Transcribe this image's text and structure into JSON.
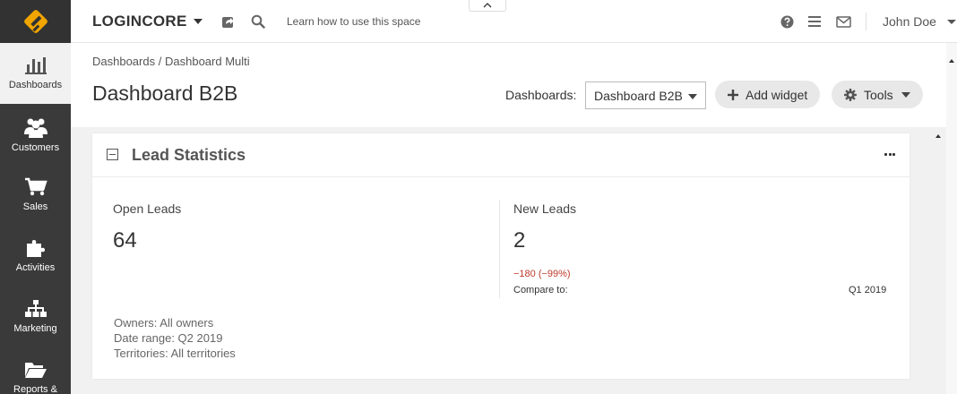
{
  "sidebar": {
    "items": [
      {
        "label": "Dashboards",
        "icon": "bar-chart-icon",
        "active": true
      },
      {
        "label": "Customers",
        "icon": "users-icon",
        "active": false
      },
      {
        "label": "Sales",
        "icon": "cart-icon",
        "active": false
      },
      {
        "label": "Activities",
        "icon": "puzzle-icon",
        "active": false
      },
      {
        "label": "Marketing",
        "icon": "sitemap-icon",
        "active": false
      },
      {
        "label": "Reports &",
        "icon": "folder-open-icon",
        "active": false
      }
    ]
  },
  "header": {
    "brand": "LOGINCORE",
    "learn_link": "Learn how to use this space",
    "user_name": "John Doe"
  },
  "page": {
    "breadcrumb": {
      "root": "Dashboards",
      "separator": "/",
      "current": "Dashboard Multi"
    },
    "title": "Dashboard B2B",
    "dashboards_label": "Dashboards:",
    "dashboards_selected": "Dashboard B2B",
    "add_widget_label": "Add widget",
    "tools_label": "Tools"
  },
  "widget": {
    "title": "Lead Statistics",
    "open_leads": {
      "label": "Open Leads",
      "value": "64"
    },
    "new_leads": {
      "label": "New Leads",
      "value": "2",
      "delta": "−180 (−99%)",
      "compare_label": "Compare to:",
      "compare_value": "Q1 2019"
    },
    "filters": {
      "owners": "Owners: All owners",
      "date_range": "Date range: Q2 2019",
      "territories": "Territories: All territories"
    }
  },
  "colors": {
    "sidebar_bg": "#3a3a3a",
    "logo_accent": "#f0a500",
    "negative_delta": "#c0392b"
  }
}
